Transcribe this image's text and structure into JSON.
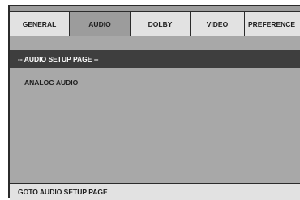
{
  "tabs": [
    {
      "label": "GENERAL",
      "active": false
    },
    {
      "label": "AUDIO",
      "active": true
    },
    {
      "label": "DOLBY",
      "active": false
    },
    {
      "label": "VIDEO",
      "active": false
    },
    {
      "label": "PREFERENCE",
      "active": false
    }
  ],
  "header": {
    "title": "-- AUDIO SETUP PAGE --"
  },
  "menu": {
    "items": [
      {
        "label": "ANALOG AUDIO"
      }
    ]
  },
  "status_bar": {
    "text": "GOTO AUDIO SETUP PAGE"
  },
  "colors": {
    "tab_bar": "#e2e2e2",
    "tab_active": "#9c9c9c",
    "header_bar": "#3e3e3e",
    "content_bg": "#a8a8a8"
  }
}
